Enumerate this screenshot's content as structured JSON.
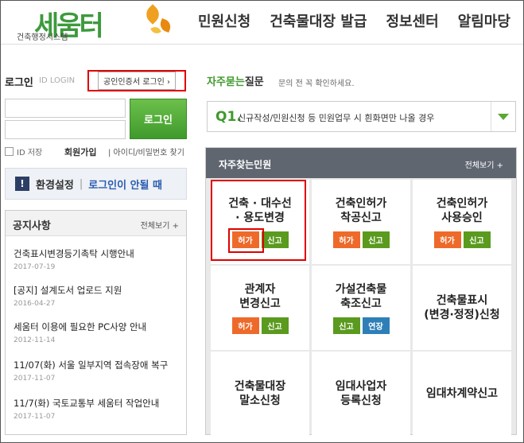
{
  "header": {
    "logo_text": "세움터",
    "logo_sub": "건축행정시스템",
    "nav": [
      "민원신청",
      "건축물대장 발급",
      "정보센터",
      "알림마당"
    ]
  },
  "login": {
    "title": "로그인",
    "sub": "ID LOGIN",
    "cert_button": "공인인증서 로그인 ›",
    "login_button": "로그인",
    "save_id": "ID 저장",
    "join": "회원가입",
    "find": "| 아이디/비밀번호 찾기"
  },
  "env": {
    "icon": "!",
    "label": "환경설정",
    "separator": "|",
    "help": "로그인이 안될 때"
  },
  "notice": {
    "title": "공지사항",
    "more": "전체보기 +",
    "items": [
      {
        "title": "건축표시변경등기촉탁 시행안내",
        "date": "2017-07-19"
      },
      {
        "title": "[공지] 설계도서 업로드 지원",
        "date": "2016-04-27"
      },
      {
        "title": "세움터 이용에 필요한 PC사양 안내",
        "date": "2012-11-14"
      },
      {
        "title": "11/07(화) 서울 일부지역 접속장애 복구",
        "date": "2017-11-07"
      },
      {
        "title": "11/7(화) 국토교통부 세움터 작업안내",
        "date": "2017-11-07"
      }
    ]
  },
  "faq": {
    "title_highlight": "자주묻는",
    "title_rest": "질문",
    "desc": "문의 전 꼭 확인하세요.",
    "q_label": "Q1.",
    "q_text": "신규작성/민원신청 등 민원업무 시 흰화면만 나올 경우"
  },
  "services": {
    "title": "자주찾는민원",
    "more": "전체보기 +",
    "cells": [
      {
        "title": "건축 · 대수선\n· 용도변경",
        "tags": [
          {
            "label": "허가",
            "color": "org"
          },
          {
            "label": "신고",
            "color": "grn"
          }
        ]
      },
      {
        "title": "건축인허가\n착공신고",
        "tags": [
          {
            "label": "허가",
            "color": "org"
          },
          {
            "label": "신고",
            "color": "grn"
          }
        ]
      },
      {
        "title": "건축인허가\n사용승인",
        "tags": [
          {
            "label": "허가",
            "color": "org"
          },
          {
            "label": "신고",
            "color": "grn"
          }
        ]
      },
      {
        "title": "관계자\n변경신고",
        "tags": [
          {
            "label": "허가",
            "color": "org"
          },
          {
            "label": "신고",
            "color": "grn"
          }
        ]
      },
      {
        "title": "가설건축물\n축조신고",
        "tags": [
          {
            "label": "신고",
            "color": "grn"
          },
          {
            "label": "연장",
            "color": "blu"
          }
        ]
      },
      {
        "title": "건축물표시\n(변경·정정)신청",
        "tags": []
      },
      {
        "title": "건축물대장\n말소신청",
        "tags": []
      },
      {
        "title": "임대사업자\n등록신청",
        "tags": []
      },
      {
        "title": "임대차계약신고",
        "tags": []
      }
    ]
  },
  "colors": {
    "green": "#3f9a2c",
    "orange": "#ee6a2a",
    "blue": "#2e7fb8",
    "highlight": "#e00000",
    "panel_head": "#5f6670"
  }
}
